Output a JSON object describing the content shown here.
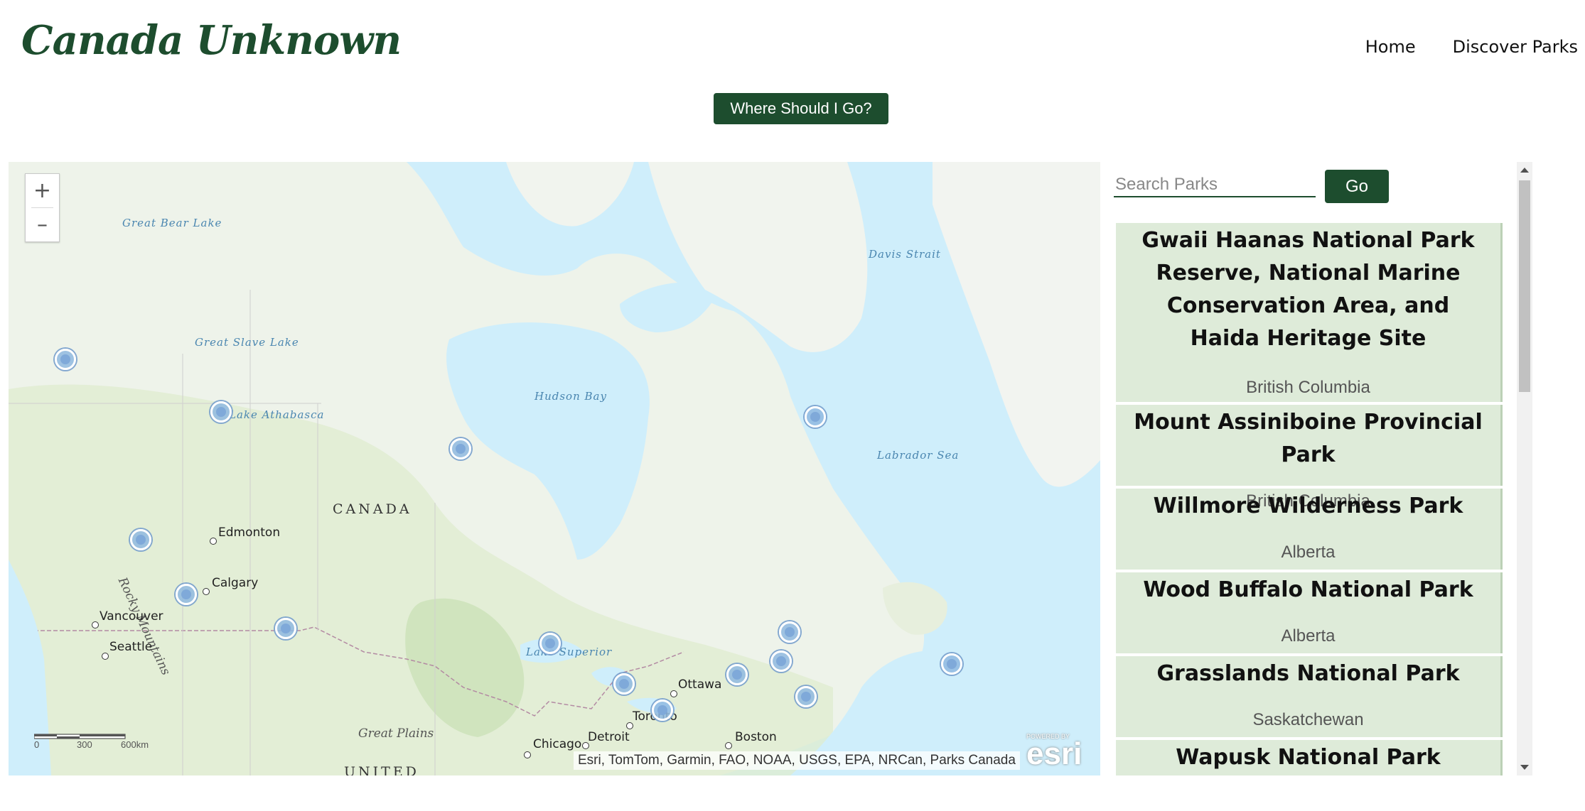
{
  "header": {
    "logo": "Canada Unknown",
    "nav": [
      "Home",
      "Discover Parks"
    ]
  },
  "cta_label": "Where Should I Go?",
  "map": {
    "zoom_in": "+",
    "zoom_out": "–",
    "labels": {
      "canada": "CANADA",
      "united": "UNITED",
      "great_plains": "Great Plains",
      "rocky_mountains": "Rocky Mountains",
      "great_bear_lake": "Great Bear Lake",
      "great_slave_lake": "Great Slave Lake",
      "lake_athabasca": "Lake Athabasca",
      "hudson_bay": "Hudson Bay",
      "davis_strait": "Davis Strait",
      "labrador_sea": "Labrador Sea",
      "lake_superior": "Lake Superior"
    },
    "cities": [
      "Edmonton",
      "Calgary",
      "Vancouver",
      "Seattle",
      "Ottawa",
      "Toronto",
      "Detroit",
      "Chicago",
      "Boston"
    ],
    "scale": [
      "0",
      "300",
      "600km"
    ],
    "attribution": "Esri, TomTom, Garmin, FAO, NOAA, USGS, EPA, NRCan, Parks Canada",
    "esri_small": "POWERED BY",
    "esri_big": "esri"
  },
  "search": {
    "placeholder": "Search Parks",
    "go": "Go"
  },
  "parks": [
    {
      "name": "Gwaii Haanas National Park Reserve, National Marine Conservation Area, and Haida Heritage Site",
      "province": "British Columbia"
    },
    {
      "name": "Mount Assiniboine Provincial Park",
      "province": "British Columbia"
    },
    {
      "name": "Willmore Wilderness Park",
      "province": "Alberta"
    },
    {
      "name": "Wood Buffalo National Park",
      "province": "Alberta"
    },
    {
      "name": "Grasslands National Park",
      "province": "Saskatchewan"
    },
    {
      "name": "Wapusk National Park",
      "province": ""
    }
  ]
}
